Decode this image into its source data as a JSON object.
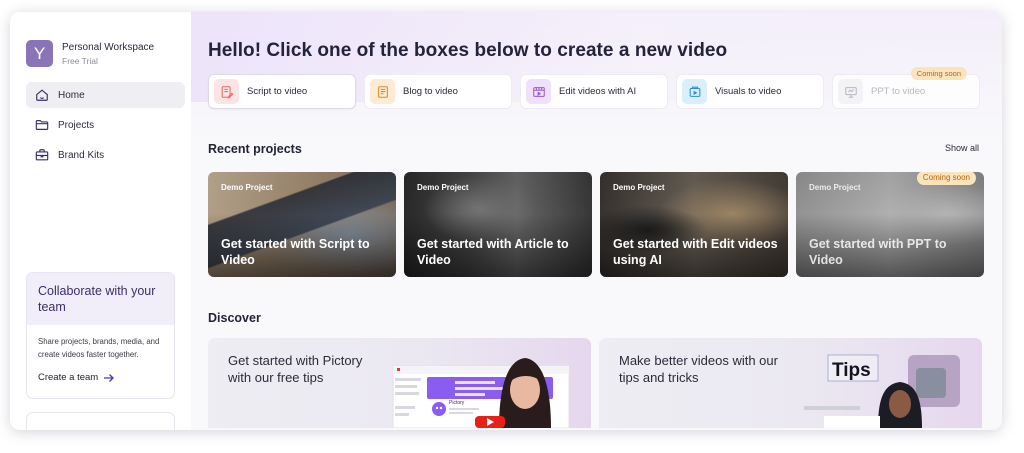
{
  "workspace": {
    "avatar": "Y",
    "name": "Personal Workspace",
    "plan": "Free Trial"
  },
  "nav": [
    {
      "label": "Home",
      "icon": "home-icon",
      "active": true
    },
    {
      "label": "Projects",
      "icon": "folder-icon"
    },
    {
      "label": "Brand Kits",
      "icon": "briefcase-icon"
    }
  ],
  "collab": {
    "title": "Collaborate with your team",
    "body": "Share projects, brands, media, and create videos faster together.",
    "cta": "Create a team"
  },
  "greeting": "Hello! Click one of the boxes below to create a new video",
  "actions": [
    {
      "label": "Script to video",
      "icon": "script-icon",
      "color": "#fde4e4"
    },
    {
      "label": "Blog to video",
      "icon": "blog-icon",
      "color": "#fdebd3"
    },
    {
      "label": "Edit videos with AI",
      "icon": "edit-video-icon",
      "color": "#efe0fb"
    },
    {
      "label": "Visuals to video",
      "icon": "visuals-icon",
      "color": "#d9f0fb"
    },
    {
      "label": "PPT to video",
      "icon": "ppt-icon",
      "badge": "Coming soon",
      "disabled": true
    }
  ],
  "recent": {
    "title": "Recent projects",
    "show_all": "Show all",
    "items": [
      {
        "tag": "Demo Project",
        "title": "Get started with Script to Video"
      },
      {
        "tag": "Demo Project",
        "title": "Get started with Article to Video"
      },
      {
        "tag": "Demo Project",
        "title": "Get started with Edit videos using AI"
      },
      {
        "tag": "Demo Project",
        "title": "Get started with PPT to Video",
        "badge": "Coming soon"
      }
    ]
  },
  "discover": {
    "title": "Discover",
    "items": [
      {
        "text": "Get started with Pictory with our free tips"
      },
      {
        "text": "Make better videos with our tips and tricks",
        "overlay": "Tips"
      }
    ],
    "mock": {
      "brand": "Pictory"
    }
  }
}
